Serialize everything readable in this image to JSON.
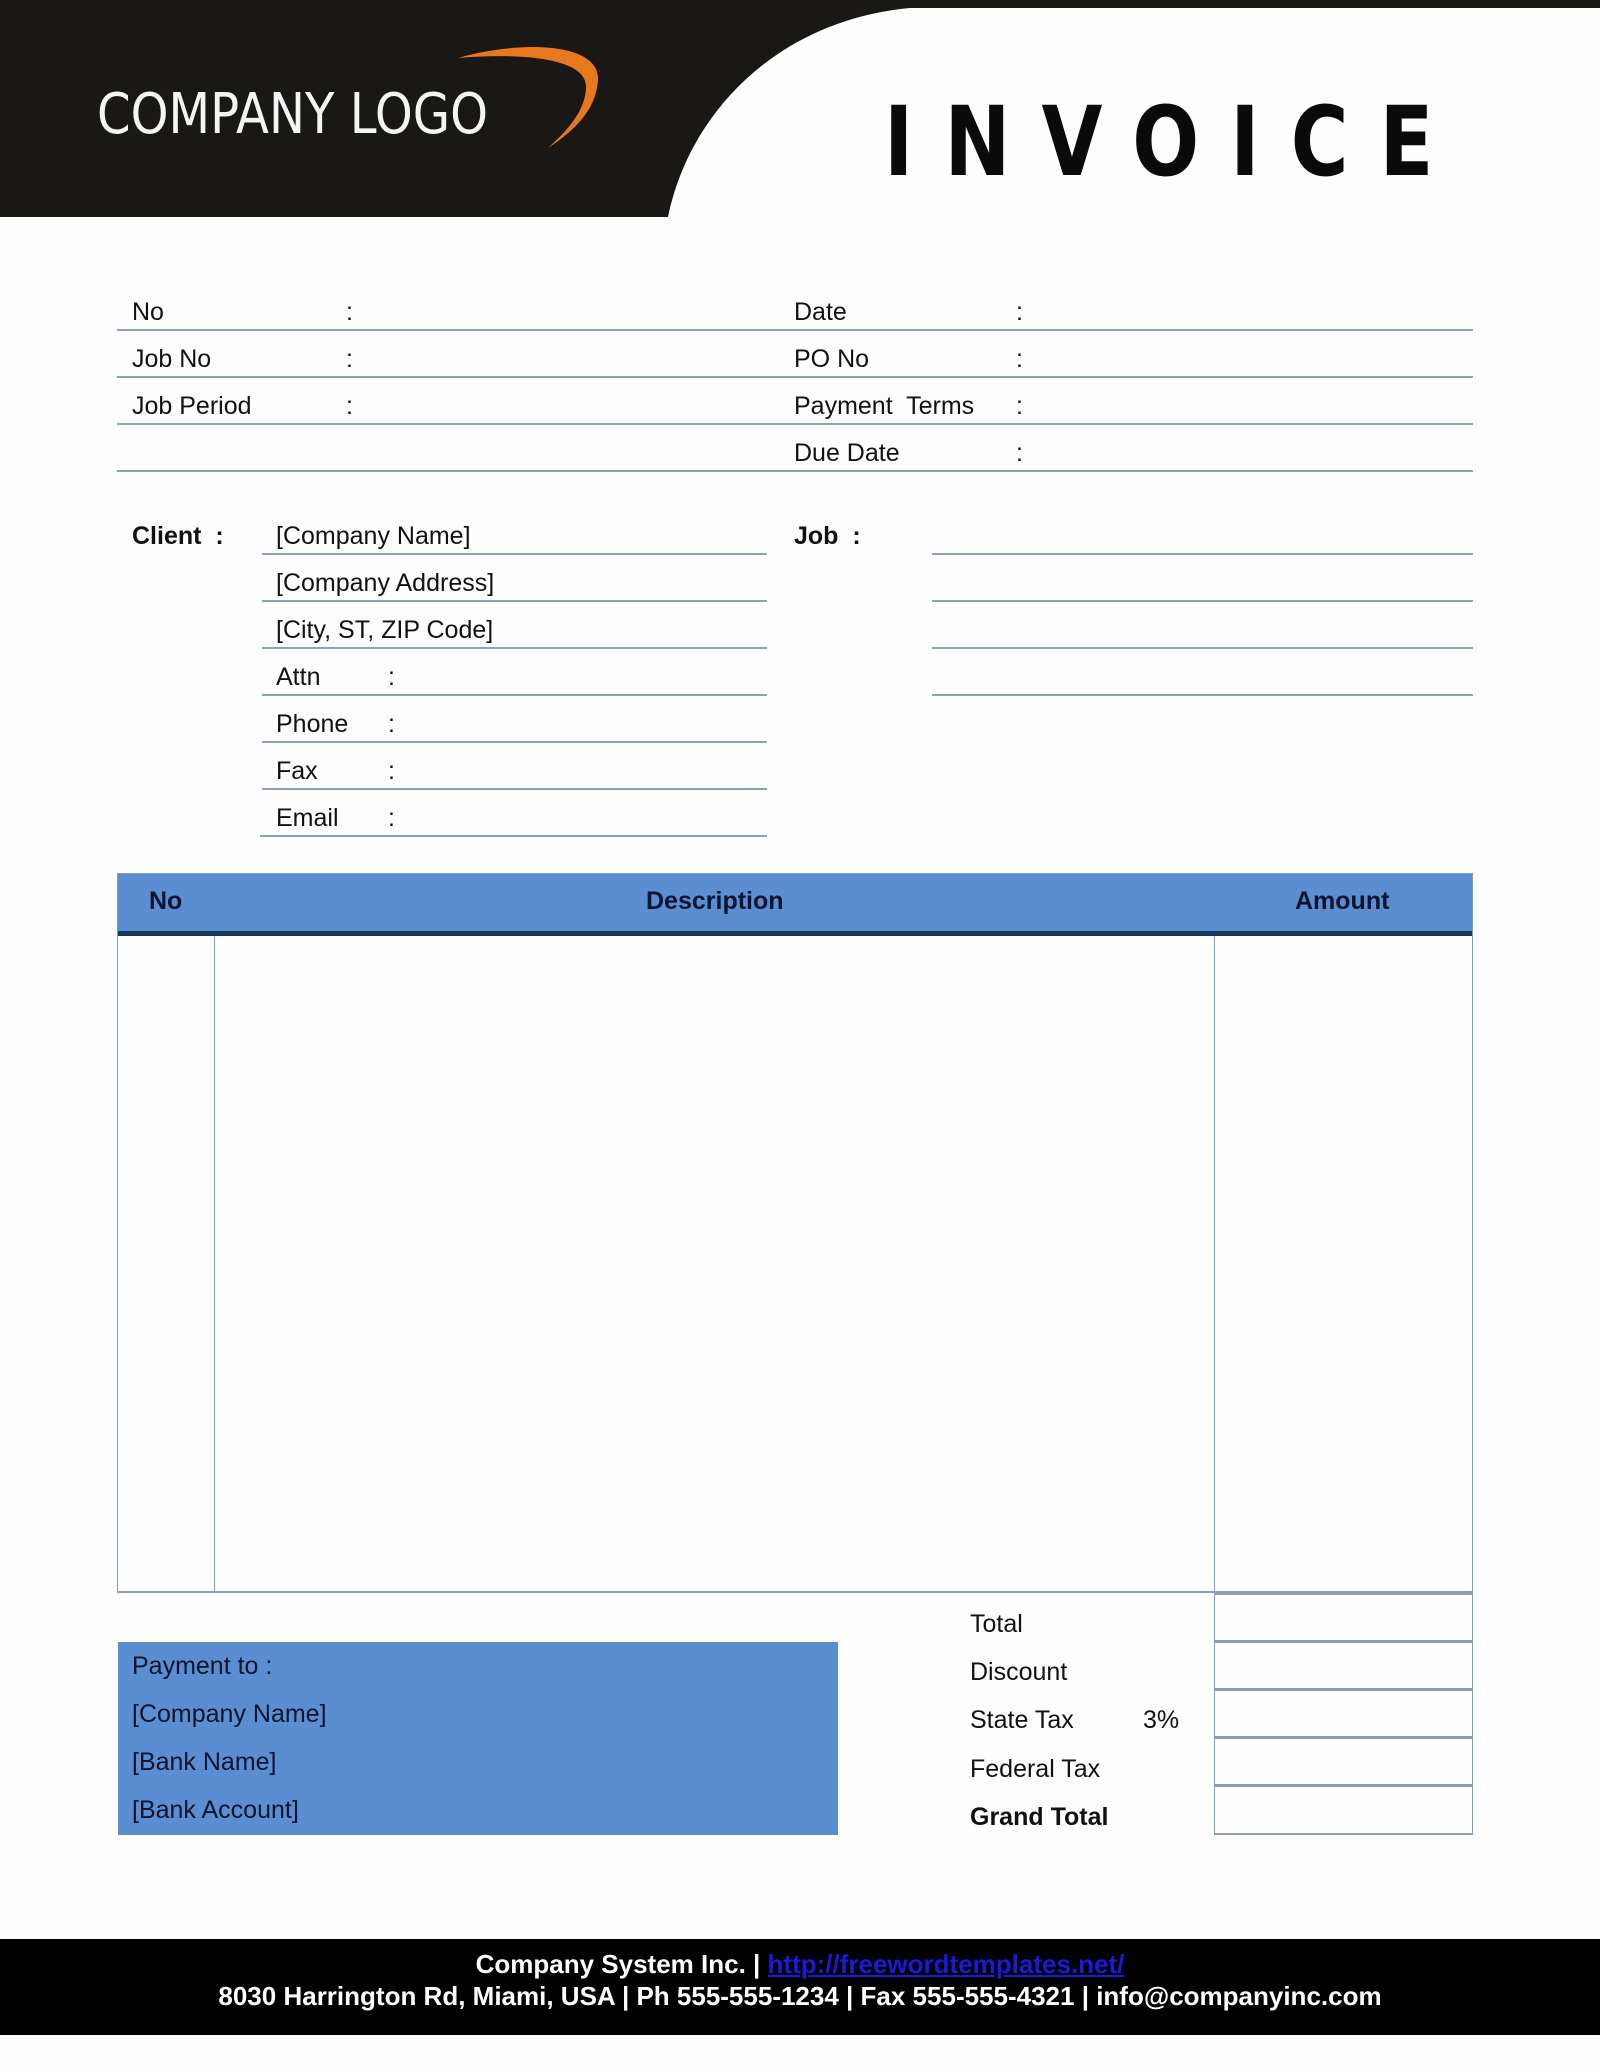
{
  "header": {
    "logo_text": "COMPANY LOGO",
    "title": "INVOICE",
    "colors": {
      "band": "#1a1814",
      "logo_swoosh": "#e8781e"
    }
  },
  "meta_left": [
    {
      "label": "No",
      "colon": ":",
      "value": ""
    },
    {
      "label": "Job No",
      "colon": ":",
      "value": ""
    },
    {
      "label": "Job Period",
      "colon": ":",
      "value": ""
    }
  ],
  "meta_right": [
    {
      "label": "Date",
      "colon": ":",
      "value": ""
    },
    {
      "label": "PO No",
      "colon": ":",
      "value": ""
    },
    {
      "label": "Payment  Terms",
      "colon": ":",
      "value": ""
    },
    {
      "label": "Due Date",
      "colon": ":",
      "value": ""
    }
  ],
  "client": {
    "label": "Client  :",
    "lines": [
      "[Company Name]",
      "[Company Address]",
      "[City, ST, ZIP Code]"
    ],
    "fields": [
      {
        "label": "Attn",
        "colon": ":"
      },
      {
        "label": "Phone",
        "colon": ":"
      },
      {
        "label": "Fax",
        "colon": ":"
      },
      {
        "label": "Email",
        "colon": ":"
      }
    ]
  },
  "job": {
    "label": "Job  :",
    "lines": [
      "",
      "",
      "",
      ""
    ]
  },
  "items_table": {
    "columns": [
      "No",
      "Description",
      "Amount"
    ],
    "rows": [],
    "header_color": "#5a8ed0"
  },
  "totals": [
    {
      "label": "Total",
      "rate": "",
      "value": ""
    },
    {
      "label": "Discount",
      "rate": "",
      "value": ""
    },
    {
      "label": "State Tax",
      "rate": "3%",
      "value": ""
    },
    {
      "label": "Federal Tax",
      "rate": "",
      "value": ""
    },
    {
      "label": "Grand Total",
      "rate": "",
      "value": ""
    }
  ],
  "payment": {
    "title": "Payment to :",
    "lines": [
      "[Company Name]",
      "[Bank Name]",
      "[Bank Account]"
    ]
  },
  "footer": {
    "company": "Company System Inc. |",
    "link": "http://freewordtemplates.net/",
    "address_line": "8030 Harrington Rd, Miami, USA | Ph 555-555-1234 | Fax 555-555-4321 | info@companyinc.com"
  }
}
